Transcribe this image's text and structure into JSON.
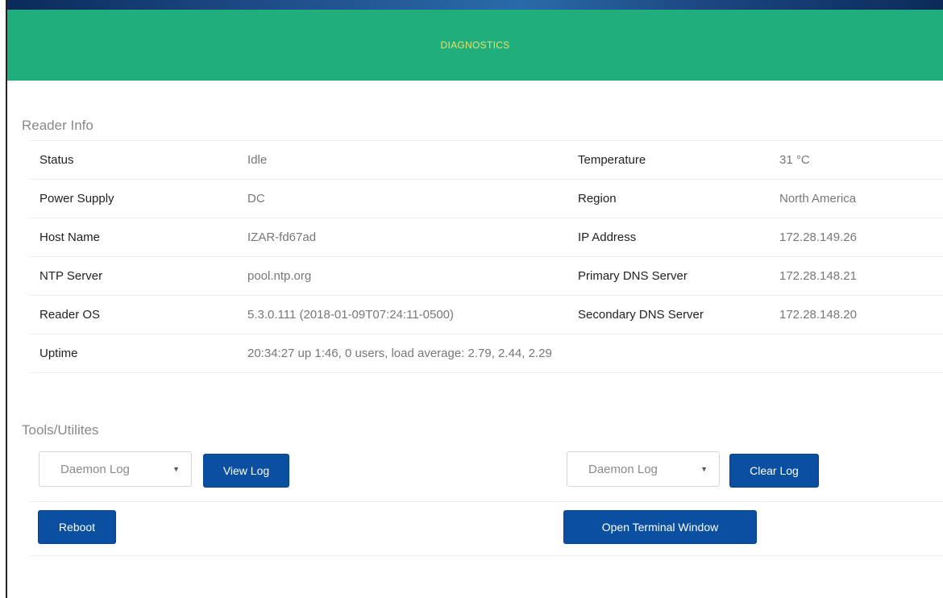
{
  "header": {
    "title": "DIAGNOSTICS"
  },
  "reader_info": {
    "heading": "Reader Info",
    "rows": [
      {
        "label1": "Status",
        "value1": "Idle",
        "label2": "Temperature",
        "value2": "31 °C"
      },
      {
        "label1": "Power Supply",
        "value1": "DC",
        "label2": "Region",
        "value2": "North America"
      },
      {
        "label1": "Host Name",
        "value1": "IZAR-fd67ad",
        "label2": "IP Address",
        "value2": "172.28.149.26"
      },
      {
        "label1": "NTP Server",
        "value1": "pool.ntp.org",
        "label2": "Primary DNS Server",
        "value2": "172.28.148.21"
      },
      {
        "label1": "Reader OS",
        "value1": "5.3.0.111 (2018-01-09T07:24:11-0500)",
        "label2": "Secondary DNS Server",
        "value2": "172.28.148.20"
      },
      {
        "label1": "Uptime",
        "value1": "20:34:27 up 1:46, 0 users, load average: 2.79, 2.44, 2.29",
        "label2": "",
        "value2": ""
      }
    ]
  },
  "tools": {
    "heading": "Tools/Utilites",
    "log_select_left": "Daemon Log",
    "view_log_label": "View Log",
    "log_select_right": "Daemon Log",
    "clear_log_label": "Clear Log",
    "reboot_label": "Reboot",
    "terminal_label": "Open Terminal Window"
  },
  "colors": {
    "header_bg": "#1fae7c",
    "header_text": "#e9e36a",
    "button_bg": "#0a4fa0"
  }
}
